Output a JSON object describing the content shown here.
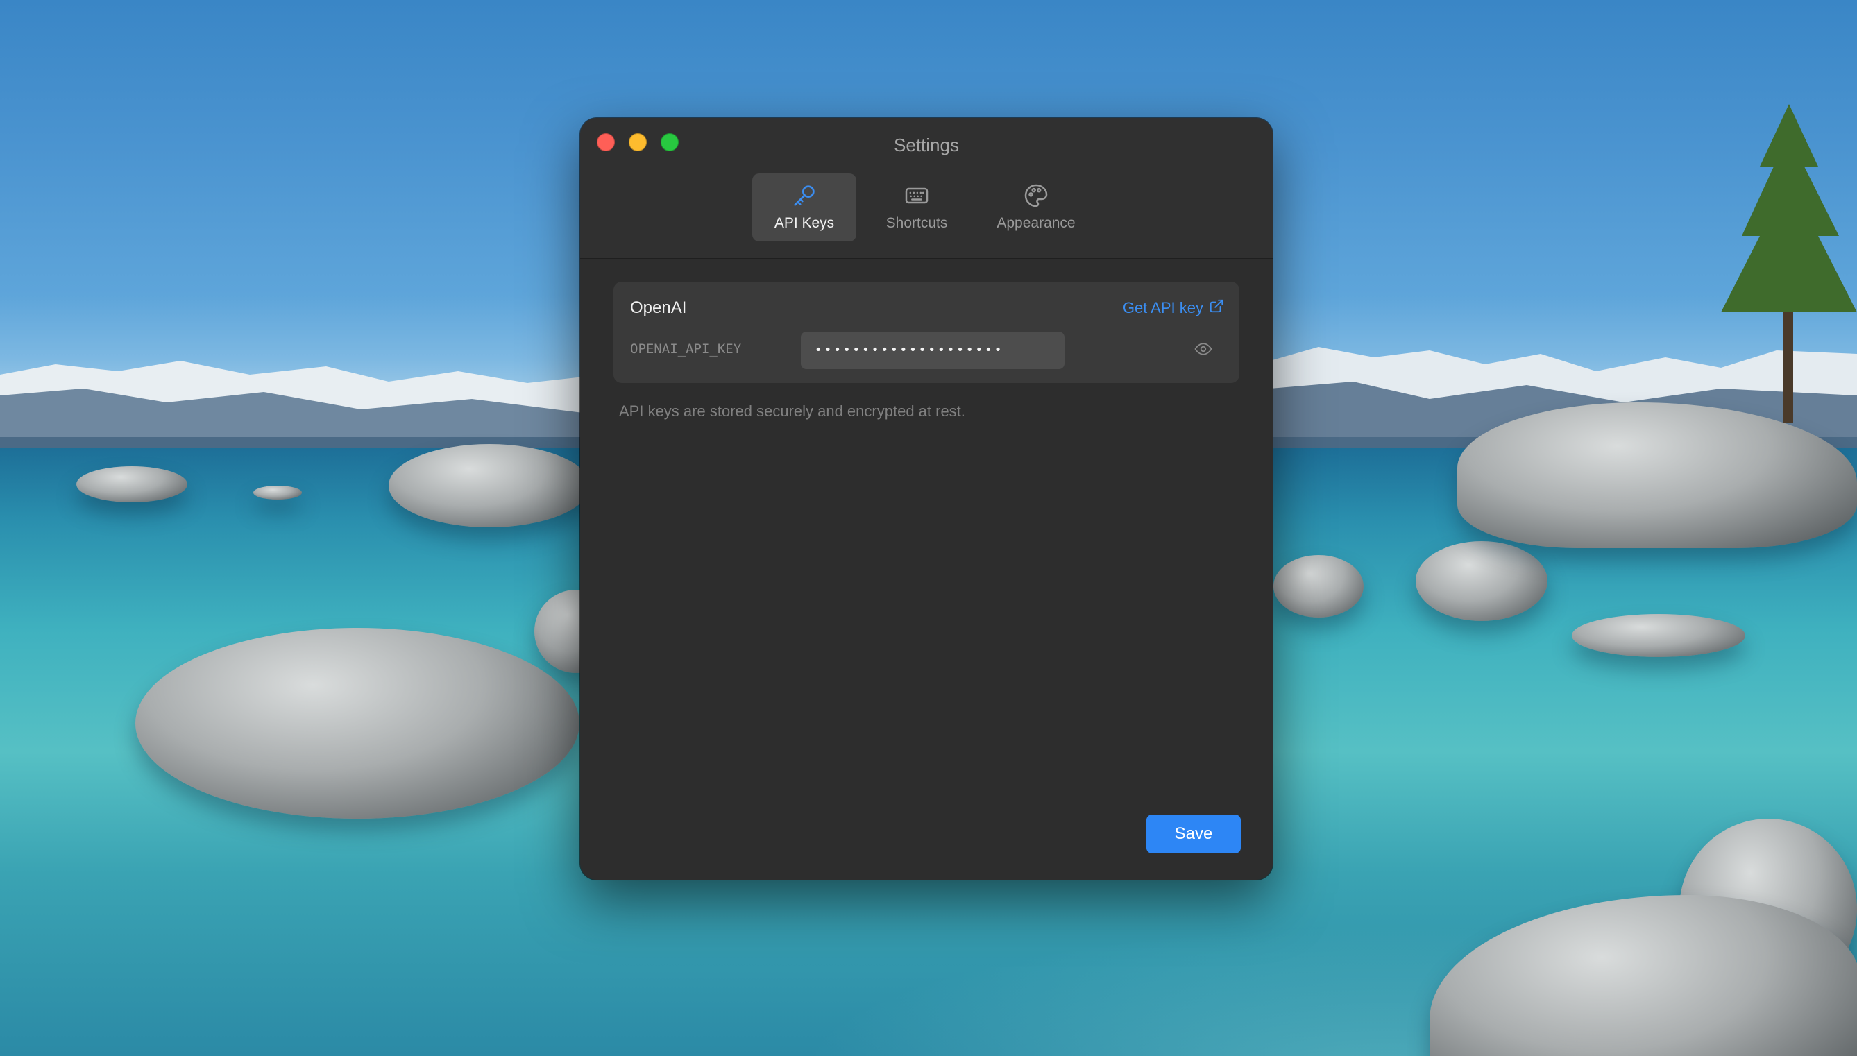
{
  "window": {
    "title": "Settings"
  },
  "tabs": [
    {
      "label": "API Keys",
      "icon": "key-icon",
      "active": true
    },
    {
      "label": "Shortcuts",
      "icon": "keyboard-icon",
      "active": false
    },
    {
      "label": "Appearance",
      "icon": "palette-icon",
      "active": false
    }
  ],
  "provider": {
    "name": "OpenAI",
    "get_key_label": "Get API key",
    "env_var": "OPENAI_API_KEY",
    "masked_value": "••••••••••••••••••••"
  },
  "note": "API keys are stored securely and encrypted at rest.",
  "save_label": "Save",
  "colors": {
    "accent": "#2d86f5",
    "link": "#3b8ef2",
    "close": "#ff5f57",
    "minimize": "#febc2e",
    "maximize": "#28c840"
  }
}
